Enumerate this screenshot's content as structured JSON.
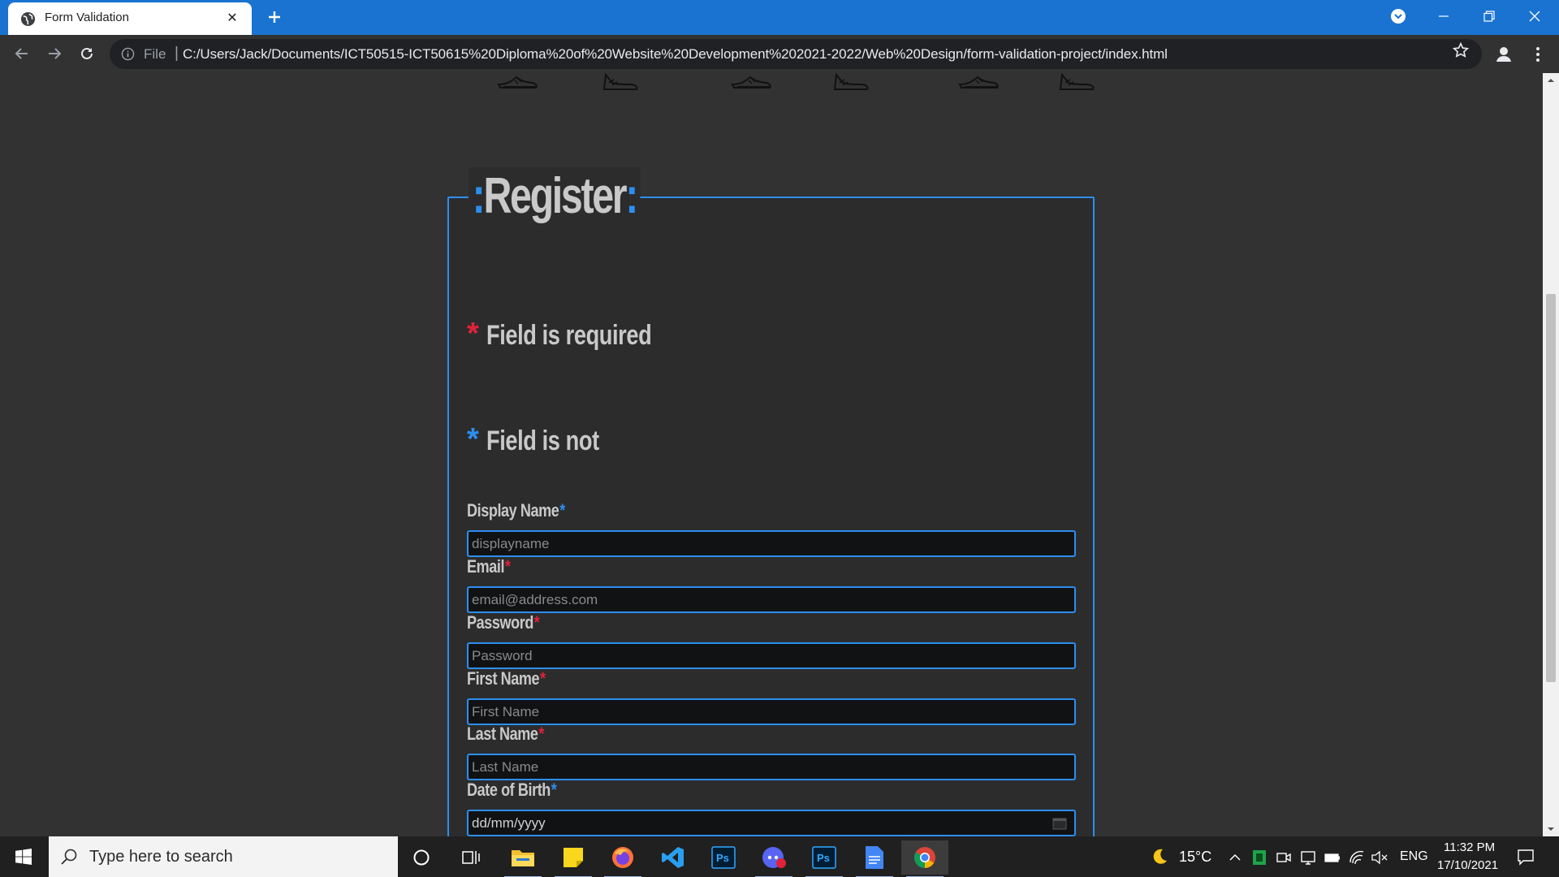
{
  "browser": {
    "tab_title": "Form Validation",
    "tab_close": "✕",
    "address_scheme": "File",
    "address_separator": "|",
    "address_url": "C:/Users/Jack/Documents/ICT50515-ICT50615%20Diploma%20of%20Website%20Development%202021-2022/Web%20Design/form-validation-project/index.html"
  },
  "form": {
    "legend_colon_left": ":",
    "legend_title": "Register",
    "legend_colon_right": ":",
    "key_required_star": "*",
    "key_required_text": "Field is required",
    "key_required_color": "#e0223a",
    "key_optional_star": "*",
    "key_optional_text": "Field is not",
    "key_optional_color": "#2d8ef0",
    "fields": [
      {
        "label": "Display Name",
        "star": "*",
        "placeholder": "displayname"
      },
      {
        "label": "Email",
        "star": "*",
        "placeholder": "email@address.com"
      },
      {
        "label": "Password",
        "star": "*",
        "placeholder": "Password"
      },
      {
        "label": "First Name",
        "star": "*",
        "placeholder": "First Name"
      },
      {
        "label": "Last Name",
        "star": "*",
        "placeholder": "Last Name"
      },
      {
        "label": "Date of Birth",
        "star": "*",
        "value": "dd/mm/yyyy"
      }
    ]
  },
  "taskbar": {
    "search_placeholder": "Type here to search",
    "weather_temp": "15°C",
    "language": "ENG",
    "time": "11:32 PM",
    "date": "17/10/2021",
    "apps": [
      "file-explorer-icon",
      "sticky-notes-icon",
      "firefox-icon",
      "vscode-icon",
      "photoshop-icon",
      "discord-icon",
      "photoshop-icon",
      "docs-icon",
      "chrome-icon"
    ]
  },
  "colors": {
    "accent": "#2d8ef0",
    "required": "#e0223a",
    "chrome_blue": "#1a73d1"
  }
}
